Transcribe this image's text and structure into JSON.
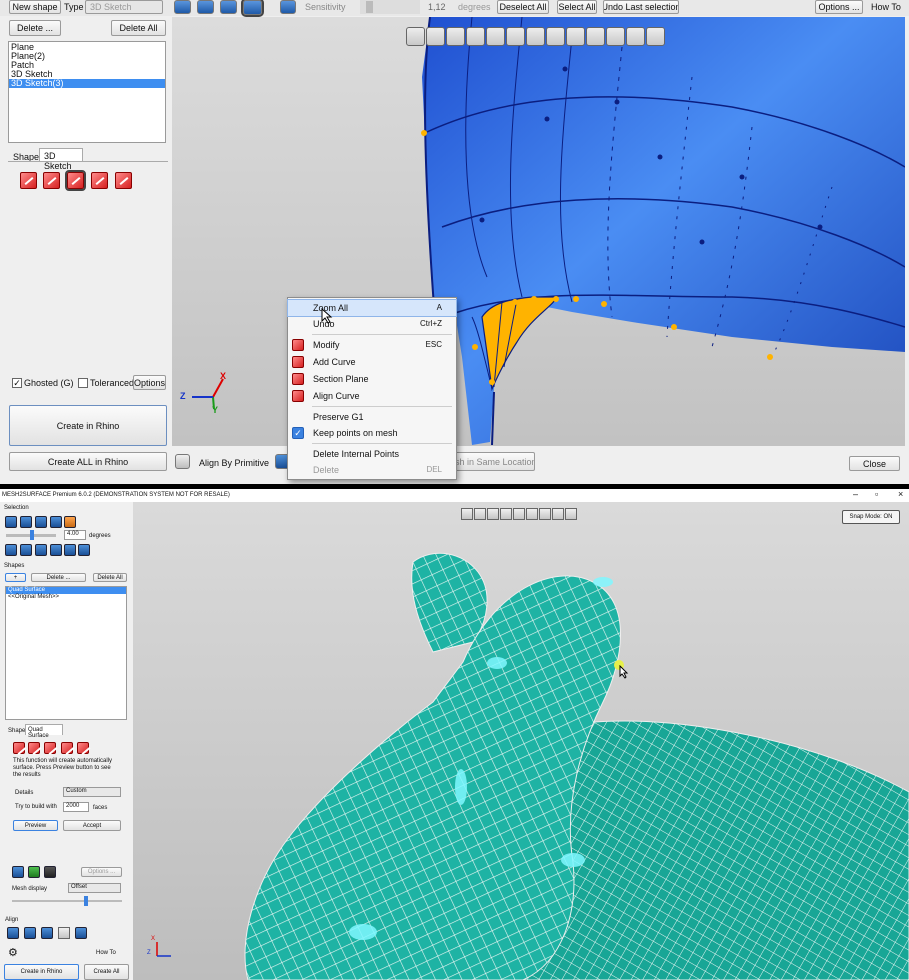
{
  "top": {
    "toolbar": {
      "new_shape": "New shape",
      "type_label": "Type",
      "type_value": "3D Sketch",
      "sensitivity_label": "Sensitivity",
      "sensitivity_value": "1,12",
      "degrees": "degrees",
      "deselect_all": "Deselect All",
      "select_all": "Select All",
      "undo_last": "Undo Last selection",
      "options": "Options ...",
      "how_to": "How To"
    },
    "panel": {
      "delete": "Delete ...",
      "delete_all": "Delete All",
      "shapes": [
        "Plane",
        "Plane(2)",
        "Patch",
        "3D Sketch",
        "3D Sketch(3)"
      ],
      "selected_index": 4,
      "tab_shape": "Shape",
      "tab_sketch": "3D Sketch",
      "ghosted": "Ghosted (G)",
      "toleranced": "Toleranced",
      "options": "Options",
      "create_in_rhino": "Create in Rhino",
      "create_all_in_rhino": "Create ALL in Rhino"
    },
    "bottom_bar": {
      "align_by_primitive": "Align By Primitive",
      "same_location": "sh in Same Location",
      "close": "Close"
    },
    "context_menu": {
      "items": [
        {
          "label": "Zoom All",
          "shortcut": "A"
        },
        {
          "label": "Undo",
          "shortcut": "Ctrl+Z"
        },
        {
          "label": "Modify",
          "shortcut": "ESC"
        },
        {
          "label": "Add Curve",
          "shortcut": ""
        },
        {
          "label": "Section Plane",
          "shortcut": ""
        },
        {
          "label": "Align Curve",
          "shortcut": ""
        },
        {
          "label": "Preserve G1",
          "shortcut": ""
        },
        {
          "label": "Keep points on mesh",
          "shortcut": ""
        },
        {
          "label": "Delete Internal Points",
          "shortcut": ""
        },
        {
          "label": "Delete",
          "shortcut": "DEL"
        }
      ]
    },
    "axes": {
      "x": "X",
      "y": "Y",
      "z": "Z"
    }
  },
  "bottom": {
    "title": "MESH2SURFACE Premium 6.0.2 (DEMONSTRATION SYSTEM NOT FOR RESALE)",
    "window_controls": [
      "–",
      "▫",
      "×"
    ],
    "selection_label": "Selection",
    "degrees_value": "4.00",
    "degrees": "degrees",
    "shapes_label": "Shapes",
    "add": "+",
    "delete": "Delete ...",
    "delete_all": "Delete All",
    "shape_list": [
      "Quad Surface",
      "<<Original Mesh>>"
    ],
    "tab_shape": "Shape",
    "tab_quad": "Quad Surface",
    "description": "This function will create automatically surface. Press Preview button to see the results",
    "details_label": "Details",
    "details_value": "Custom",
    "build_label": "Try to build with",
    "build_value": "2000",
    "faces": "faces",
    "preview": "Preview",
    "accept": "Accept",
    "options": "Options ...",
    "mesh_display_label": "Mesh display",
    "mesh_display_value": "Offset",
    "align_label": "Align",
    "how_to": "How To",
    "create_in_rhino": "Create in Rhino",
    "create_all": "Create All",
    "snap_mode": "Snap Mode: ON",
    "axes": {
      "x": "X",
      "z": "Z"
    }
  },
  "colors": {
    "surface_blue": "#2f6ee8",
    "patch_orange": "#ffb300",
    "mesh_teal": "#1fb5a5",
    "selection_blue": "#3e8ef0"
  }
}
